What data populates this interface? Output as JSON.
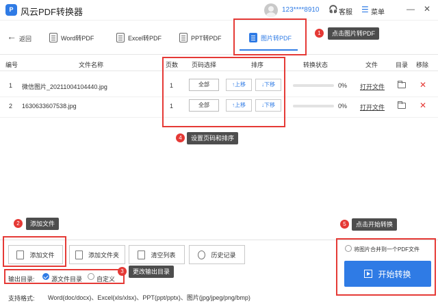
{
  "app": {
    "logo_text": "P",
    "title": "风云PDF转换器"
  },
  "header": {
    "user_name": "123****8910",
    "service_label": "客服",
    "menu_label": "菜单",
    "minimize": "—",
    "close": "✕"
  },
  "toolbar": {
    "back_label": "返回",
    "tabs": [
      {
        "label": "Word转PDF"
      },
      {
        "label": "Excel转PDF"
      },
      {
        "label": "PPT转PDF"
      },
      {
        "label": "图片转PDF"
      }
    ]
  },
  "table": {
    "headers": {
      "index": "编号",
      "name": "文件名称",
      "pages": "页数",
      "page_select": "页码选择",
      "order": "排序",
      "status": "转换状态",
      "file": "文件",
      "dir": "目录",
      "remove": "移除"
    },
    "rows": [
      {
        "index": "1",
        "name": "微信图片_20211004104440.jpg",
        "pages": "1",
        "all": "全部",
        "up": "↑上移",
        "down": "↓下移",
        "progress": 0,
        "percent": "0%",
        "open": "打开文件"
      },
      {
        "index": "2",
        "name": "1630633607538.jpg",
        "pages": "1",
        "all": "全部",
        "up": "↑上移",
        "down": "↓下移",
        "progress": 0,
        "percent": "0%",
        "open": "打开文件"
      }
    ]
  },
  "steps": [
    {
      "num": "1",
      "tip": "点击图片转PDF"
    },
    {
      "num": "2",
      "tip": "添加文件"
    },
    {
      "num": "3",
      "tip": "更改输出目录"
    },
    {
      "num": "4",
      "tip": "设置页码和排序"
    },
    {
      "num": "5",
      "tip": "点击开始转换"
    }
  ],
  "actions": {
    "add_file": "添加文件",
    "add_folder": "添加文件夹",
    "clear_list": "清空列表",
    "history": "历史记录"
  },
  "output": {
    "label": "输出目录:",
    "option_source": "源文件目录",
    "option_custom": "自定义",
    "selected": "源文件目录"
  },
  "formats": {
    "label": "支持格式:",
    "value": "Word(doc/docx)、Excel(xls/xlsx)、PPT(ppt/pptx)、图片(jpg/jpeg/png/bmp)"
  },
  "convert": {
    "merge_label": "将图片合并到一个PDF文件",
    "start_label": "开始转换"
  },
  "colors": {
    "accent": "#2f7be5",
    "annotation": "#e53935",
    "tip_bg": "#4d4d4d"
  }
}
